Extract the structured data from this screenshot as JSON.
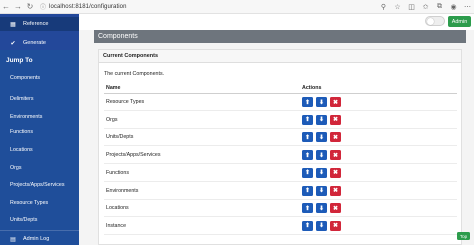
{
  "browser": {
    "url": "localhost:8181/configuration",
    "icons": [
      "back-icon",
      "forward-icon",
      "refresh-icon",
      "lock-icon",
      "extension-icon",
      "bookmark-icon",
      "profile-icon",
      "menu-icon"
    ]
  },
  "sidebar": {
    "top_items": [
      {
        "label": "Reference",
        "icon": "book-icon",
        "glyph": "▦"
      },
      {
        "label": "Generate",
        "icon": "check-icon",
        "glyph": "✔"
      }
    ],
    "jump_to_heading": "Jump To",
    "links": [
      "Components",
      "Delimiters",
      "Environments",
      "Functions",
      "Locations",
      "Orgs",
      "Projects/Apps/Services",
      "Resource Types",
      "Units/Depts"
    ],
    "admin_log": "Admin Log",
    "admin_log_glyph": "▤"
  },
  "topbar": {
    "admin_button": "Admin"
  },
  "main": {
    "section_title": "Components",
    "card_title": "Current Components",
    "description": "The current Components.",
    "col_name": "Name",
    "col_actions": "Actions",
    "rows": [
      "Resource Types",
      "Orgs",
      "Units/Depts",
      "Projects/Apps/Services",
      "Functions",
      "Environments",
      "Locations",
      "Instance"
    ],
    "actions": {
      "up_glyph": "⬆",
      "down_glyph": "⬇",
      "delete_glyph": "✖"
    }
  },
  "top_button": "Top",
  "colors": {
    "sidebar": "#1f4e9a",
    "header": "#6e757d",
    "action_blue": "#1d5bb8",
    "action_red": "#d1263a",
    "green": "#2c9c4c"
  }
}
